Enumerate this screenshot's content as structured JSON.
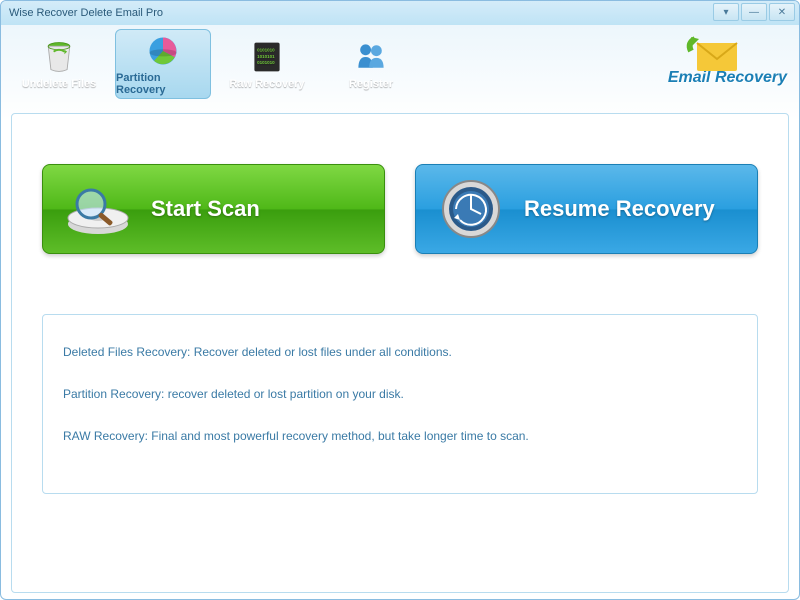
{
  "window": {
    "title": "Wise Recover Delete Email Pro"
  },
  "toolbar": {
    "items": [
      {
        "label": "Undelete Files",
        "icon": "trash-icon"
      },
      {
        "label": "Partition Recovery",
        "icon": "pie-icon"
      },
      {
        "label": "Raw Recovery",
        "icon": "matrix-icon"
      },
      {
        "label": "Register",
        "icon": "people-icon"
      }
    ]
  },
  "brand": {
    "label": "Email Recovery"
  },
  "actions": {
    "start_scan": "Start  Scan",
    "resume_recovery": "Resume Recovery"
  },
  "info": {
    "line1": "Deleted Files Recovery: Recover deleted or lost files  under all conditions.",
    "line2": "Partition Recovery: recover deleted or lost partition on your disk.",
    "line3": "RAW Recovery: Final and most powerful recovery method, but take longer time to scan."
  }
}
